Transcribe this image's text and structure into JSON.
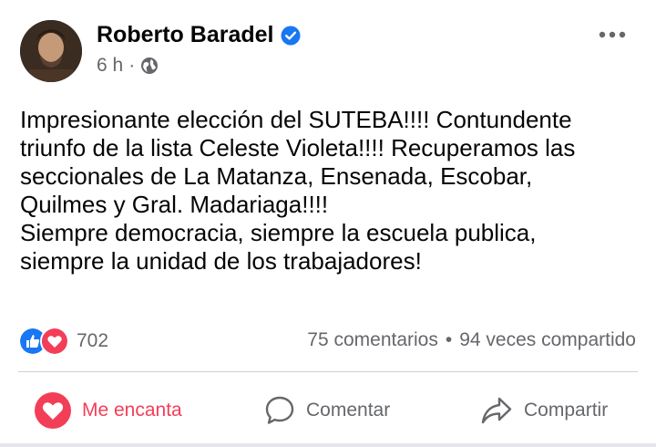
{
  "author": {
    "name": "Roberto Baradel",
    "verified": true,
    "time": "6 h",
    "separator": "·",
    "privacy_icon": "globe-icon"
  },
  "post": {
    "text": "Impresionante elección del SUTEBA!!!! Contundente\ntriunfo de la lista Celeste Violeta!!!! Recuperamos las\nseccionales de La Matanza, Ensenada, Escobar,\nQuilmes y Gral. Madariaga!!!!\nSiempre democracia, siempre la escuela publica,\nsiempre la unidad de los trabajadores!"
  },
  "stats": {
    "reaction_icons": [
      "like-icon",
      "love-icon"
    ],
    "reaction_count": "702",
    "comments": "75 comentarios",
    "separator": "•",
    "shares": "94 veces compartido"
  },
  "actions": {
    "react_label": "Me encanta",
    "comment_label": "Comentar",
    "share_label": "Compartir"
  },
  "colors": {
    "like_blue": "#1877f2",
    "love_red": "#f33e58",
    "secondary_text": "#65676b",
    "verified_blue": "#1877f2"
  }
}
